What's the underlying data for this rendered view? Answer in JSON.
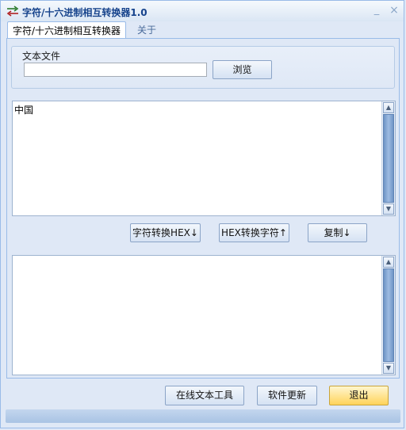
{
  "window": {
    "title": "字符/十六进制相互转换器1.0",
    "minimize_label": "_",
    "close_label": "×"
  },
  "tabs": [
    {
      "label": "字符/十六进制相互转换器",
      "active": true
    },
    {
      "label": "关于",
      "active": false
    }
  ],
  "file_group": {
    "label": "文本文件",
    "input_value": "",
    "browse_label": "浏览"
  },
  "input_text": "中国",
  "output_text": "",
  "actions": {
    "to_hex_label": "字符转换HEX↓",
    "to_char_label": "HEX转换字符↑",
    "copy_label": "复制↓"
  },
  "footer": {
    "online_tool_label": "在线文本工具",
    "update_label": "软件更新",
    "exit_label": "退出"
  },
  "scrollbar": {
    "up_arrow": "▲",
    "down_arrow": "▼"
  },
  "colors": {
    "accent": "#15428b",
    "panel": "#dfe8f6",
    "exit_button": "#ffd35a"
  }
}
